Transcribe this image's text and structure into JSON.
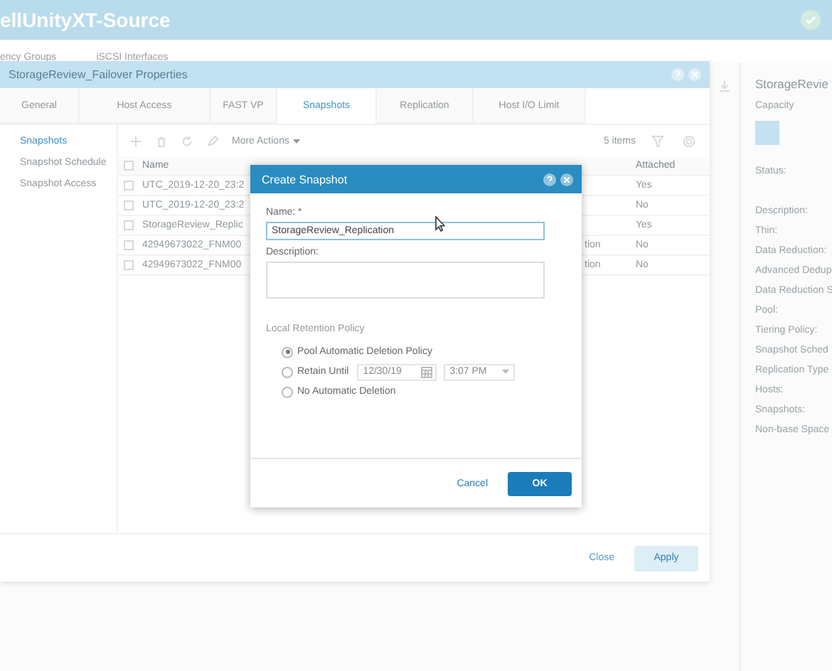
{
  "app": {
    "title": "ellUnityXT-Source",
    "tabs": [
      "ency Groups",
      "iSCSI Interfaces"
    ]
  },
  "properties": {
    "title": "StorageReview_Failover Properties",
    "tabs": [
      {
        "label": "General",
        "selected": false
      },
      {
        "label": "Host Access",
        "selected": false
      },
      {
        "label": "FAST VP",
        "selected": false
      },
      {
        "label": "Snapshots",
        "selected": true
      },
      {
        "label": "Replication",
        "selected": false
      },
      {
        "label": "Host I/O Limit",
        "selected": false
      }
    ],
    "nav": [
      {
        "label": "Snapshots",
        "selected": true
      },
      {
        "label": "Snapshot Schedule",
        "selected": false
      },
      {
        "label": "Snapshot Access",
        "selected": false
      }
    ],
    "toolbar": {
      "more_actions": "More Actions",
      "item_count": "5 items"
    },
    "table": {
      "all_checked": false,
      "columns": [
        "Name",
        "Attached"
      ],
      "rows": [
        {
          "checked": false,
          "name": "UTC_2019-12-20_23:2",
          "column_3": "",
          "attached": "Yes"
        },
        {
          "checked": false,
          "name": "UTC_2019-12-20_23:2",
          "column_3": "",
          "attached": "No"
        },
        {
          "checked": false,
          "name": "StorageReview_Replic",
          "column_3": "",
          "attached": "Yes"
        },
        {
          "checked": false,
          "name": "42949673022_FNM00",
          "column_3": "tion",
          "attached": "No"
        },
        {
          "checked": false,
          "name": "42949673022_FNM00",
          "column_3": "tion",
          "attached": "No"
        }
      ]
    },
    "buttons": [
      "Close",
      "Apply"
    ]
  },
  "detail_panel": {
    "title": "StorageRevie",
    "capacity_label": "Capacity",
    "status_label": "Status:",
    "fields": [
      "Description:",
      "Thin:",
      "Data Reduction:",
      "Advanced Dedup",
      "Data Reduction S",
      "Pool:",
      "Tiering Policy:",
      "Snapshot Sched",
      "Replication Type",
      "Hosts:",
      "Snapshots:",
      "Non-base Space"
    ]
  },
  "dialog": {
    "title": "Create Snapshot",
    "name_label": "Name: *",
    "name_value": "StorageReview_Replication",
    "description_label": "Description:",
    "policy": {
      "label": "Local Retention Policy",
      "options": [
        {
          "kind": "plain",
          "label": "Pool Automatic Deletion Policy",
          "selected": true
        },
        {
          "kind": "date",
          "label": "Retain Until",
          "selected": false
        },
        {
          "kind": "plain",
          "label": "No Automatic Deletion",
          "selected": false
        }
      ],
      "retain_date": "12/30/19",
      "retain_time": "3:07 PM",
      "disabled": true
    },
    "buttons": [
      "Cancel",
      "OK"
    ]
  }
}
